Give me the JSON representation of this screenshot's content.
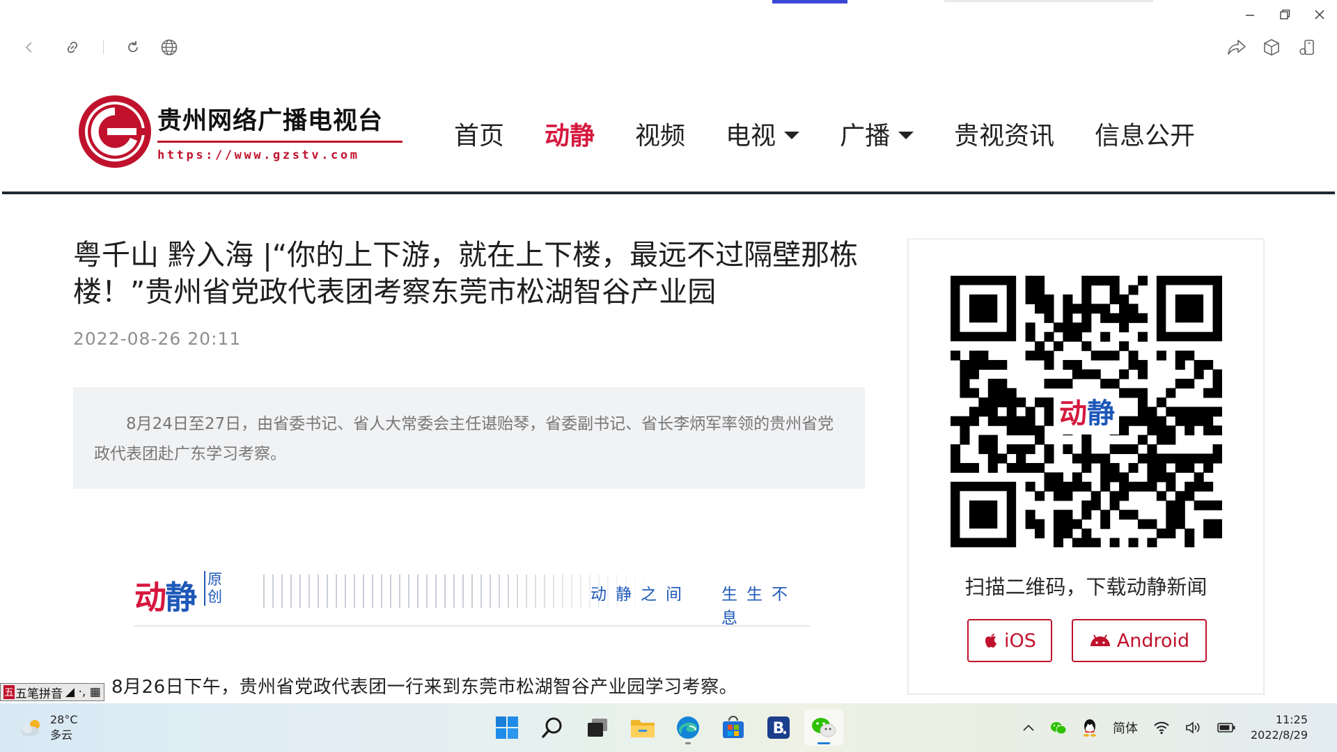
{
  "site": {
    "logo_title": "贵州网络广播电视台",
    "logo_url": "https://www.gzstv.com",
    "nav": [
      {
        "label": "首页"
      },
      {
        "label": "动静",
        "active": true
      },
      {
        "label": "视频"
      },
      {
        "label": "电视",
        "dropdown": true
      },
      {
        "label": "广播",
        "dropdown": true
      },
      {
        "label": "贵视资讯"
      },
      {
        "label": "信息公开"
      }
    ],
    "brand_color": "#d6183e",
    "accent_blue": "#1e58b8"
  },
  "article": {
    "title": "粤千山 黔入海 |“你的上下游，就在上下楼，最远不过隔壁那栋楼！”贵州省党政代表团考察东莞市松湖智谷产业园",
    "date": "2022-08-26 20:11",
    "summary": "8月24日至27日，由省委书记、省人大常委会主任谌贻琴，省委副书记、省长李炳军率领的贵州省党政代表团赴广东学习考察。",
    "banner": {
      "brand_left": "动",
      "brand_right": "静",
      "tag": "原创",
      "slogan_1": "动静之间",
      "slogan_2": "生生不息"
    },
    "first_paragraph": "8月26日下午，贵州省党政代表团一行来到东莞市松湖智谷产业园学习考察。"
  },
  "sidebar": {
    "qr_brand_left": "动",
    "qr_brand_right": "静",
    "qr_caption": "扫描二维码，下载动静新闻",
    "ios_label": "iOS",
    "android_label": "Android"
  },
  "ime": {
    "badge": "五",
    "label": "五笔拼音",
    "symbols": "◢ ·, ▦"
  },
  "taskbar": {
    "temperature": "28°C",
    "condition": "多云",
    "language": "简体",
    "time": "11:25",
    "date": "2022/8/29"
  }
}
